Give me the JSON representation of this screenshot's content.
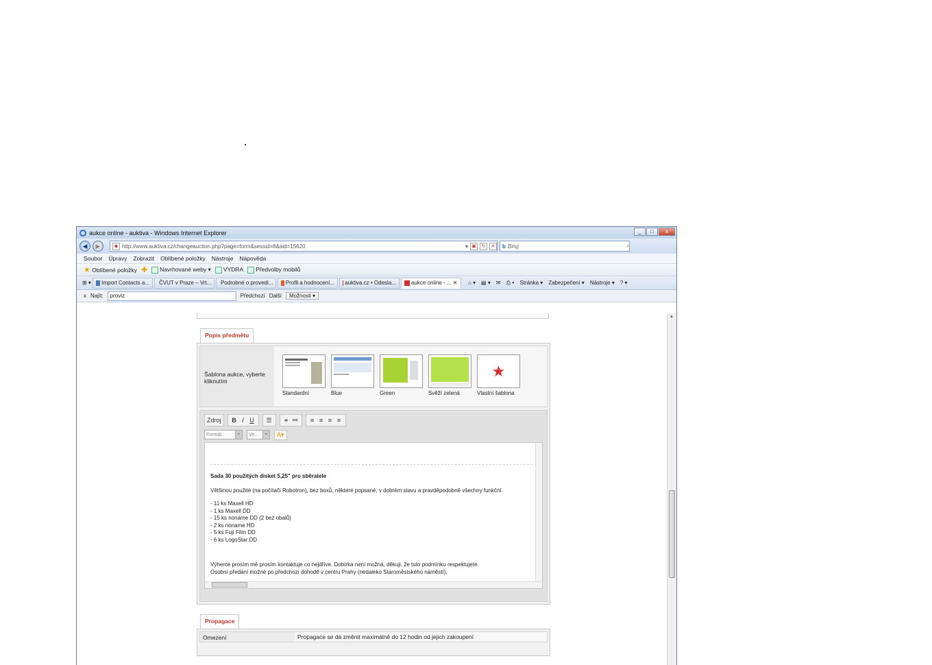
{
  "window": {
    "title": "aukce online - auktiva - Windows Internet Explorer",
    "controls": [
      "_",
      "□",
      "x"
    ]
  },
  "address": {
    "url": "http://www.auktiva.cz/changeauction.php?page=form&sessid=8&aid=15620",
    "search_placeholder": "Bing"
  },
  "menu": [
    "Soubor",
    "Úpravy",
    "Zobrazit",
    "Oblíbené položky",
    "Nástroje",
    "Nápověda"
  ],
  "favorites": {
    "label": "Oblíbené položky",
    "items": [
      "Navrhované weby ▾",
      "VYDRA",
      "Předvolby mobilů"
    ]
  },
  "tabs": [
    {
      "label": "Import Contacts a..."
    },
    {
      "label": "ČVUT v Praze – Vrt..."
    },
    {
      "label": "Podrobné o provedi..."
    },
    {
      "label": "Profil a hodnocení..."
    },
    {
      "label": "auktiva.cz • Odesla..."
    },
    {
      "label": "aukce online - ...",
      "active": true
    }
  ],
  "tab_tools": [
    "Stránka ▾",
    "Zabezpečení ▾",
    "Nástroje ▾"
  ],
  "find": {
    "close": "x",
    "label": "Najít:",
    "value": "proviz",
    "prev": "Předchozí",
    "next": "Další",
    "options": "Možnosti ▾"
  },
  "page": {
    "description_tab": "Popis předmětu",
    "template_label": "Šablona aukce, vyberte kliknutím",
    "templates": [
      "Standardní",
      "Blue",
      "Green",
      "Svěží zelená",
      "Vlastní šablona"
    ],
    "editor": {
      "toolbar_format": "Zdroj",
      "style_select": "Formát",
      "size_select": "Ve...",
      "heading": "Sada 30 použitých disket 5,25\" pro sběratele",
      "intro": "Většinou použité (na počítači Robotron), bez boxů, některé popsané, v dobrém stavu a pravděpodobně všechny funkční.",
      "items": [
        "- 11 ks Maxell HD",
        "- 1 ks Maxell DD",
        "- 15 ks noname DD (2 bez obalů)",
        "- 2 ks noname HD",
        "- 5 ks Fuji Film DD",
        "- 6 ks LogoStar DD"
      ],
      "footer1": "Výherce prosím mě prosím kontaktuje co nejdříve. Dobírka není možná, děkuji, že tuto podmínku respektujete.",
      "footer2": "Osobní předání možné po předchozí dohodě v centru Prahy (nedaleko Staroměstského náměstí)."
    },
    "promo_tab": "Propagace",
    "promo_row_key": "Omezení",
    "promo_row_value": "Propagace se dá změnit maximálně do 12 hodin od jejich zakoupení"
  }
}
